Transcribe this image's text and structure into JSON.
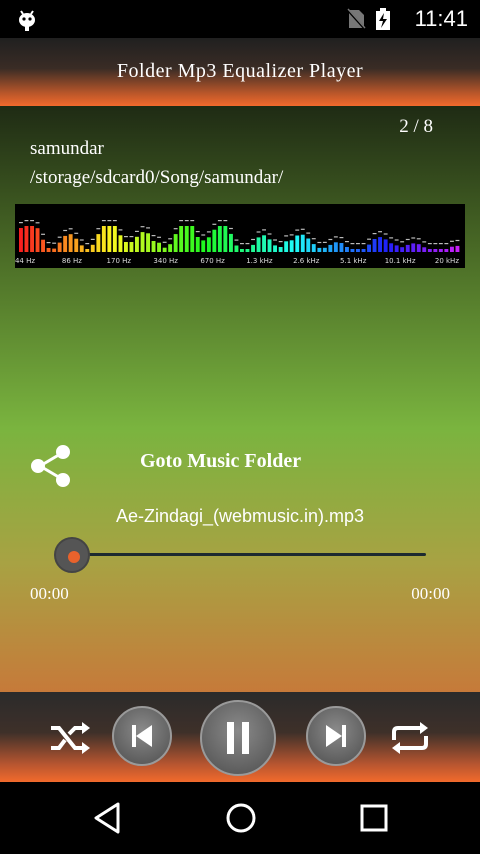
{
  "status_bar": {
    "time": "11:41"
  },
  "header": {
    "title": "Folder Mp3 Equalizer Player"
  },
  "track": {
    "counter": "2 / 8",
    "name": "samundar",
    "path": "/storage/sdcard0/Song/samundar/"
  },
  "visualizer": {
    "freq_labels": [
      "44 Hz",
      "86 Hz",
      "170 Hz",
      "340 Hz",
      "670 Hz",
      "1.3 kHz",
      "2.6 kHz",
      "5.1 kHz",
      "10.1 kHz",
      "20 kHz"
    ]
  },
  "actions": {
    "goto_folder": "Goto Music Folder"
  },
  "now_playing": {
    "file": "Ae-Zindagi_(webmusic.in).mp3"
  },
  "progress": {
    "current": "00:00",
    "total": "00:00",
    "fraction": 0.0
  },
  "controls": {
    "shuffle": "shuffle-icon",
    "previous": "skip-previous-icon",
    "pause": "pause-icon",
    "next": "skip-next-icon",
    "repeat": "repeat-icon"
  },
  "colors": {
    "accent": "#f26a2c",
    "seek_dot": "#e8622c"
  }
}
